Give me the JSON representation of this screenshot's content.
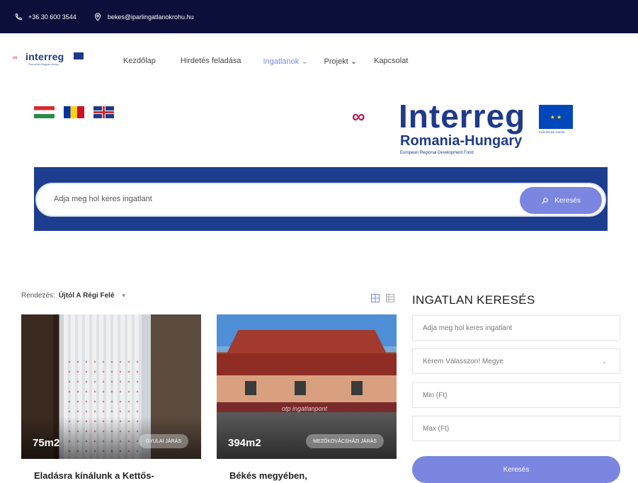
{
  "topbar": {
    "phone": "+36 30 600 3544",
    "email": "bekes@iparlingatlanokrohu.hu",
    "phone_icon": "phone-icon",
    "email_icon": "location-pin-icon"
  },
  "nav": {
    "logo_word": "interreg",
    "logo_sub": "Romania-Magyarország",
    "items": [
      {
        "label": "Kezdőlap"
      },
      {
        "label": "Hirdetés feladása"
      },
      {
        "label": "Ingatlanok",
        "dropdown": true
      },
      {
        "label": "Projekt",
        "dropdown": true
      },
      {
        "label": "Kapcsolat"
      }
    ],
    "active_color": "#7a8bd8"
  },
  "languages": [
    "Hungarian",
    "Romanian",
    "English"
  ],
  "hero_logo": {
    "word": "Interreg",
    "sub": "Romania-Hungary",
    "fund": "European Regional Development Fund",
    "eu": "EUROPEAN UNION"
  },
  "search": {
    "placeholder": "Adja meg hol keres ingatlant",
    "button": "Keresés"
  },
  "sort": {
    "label": "Rendezés:",
    "value": "Újtól A Régi Felé"
  },
  "cards": [
    {
      "size": "75m2",
      "badge": "GYULAI JÁRÁS",
      "title": "Eladásra kínálunk a Kettős-"
    },
    {
      "size": "394m2",
      "badge": "MEZŐKOVÁCSHÁZI JÁRÁS",
      "title": "Békés megyében,",
      "watermark": "otp ingatlanpont"
    }
  ],
  "sidebar": {
    "title": "INGATLAN KERESÉS",
    "location_placeholder": "Adja meg hol keres ingatlant",
    "county_placeholder": "Kérem Válasszon! Megye",
    "min_placeholder": "Min (Ft)",
    "max_placeholder": "Max (Ft)",
    "button": "Keresés"
  },
  "colors": {
    "topbar": "#0b0f3a",
    "accent": "#7b86e0",
    "band": "#1d3e8f",
    "brand": "#1f3a8a"
  }
}
